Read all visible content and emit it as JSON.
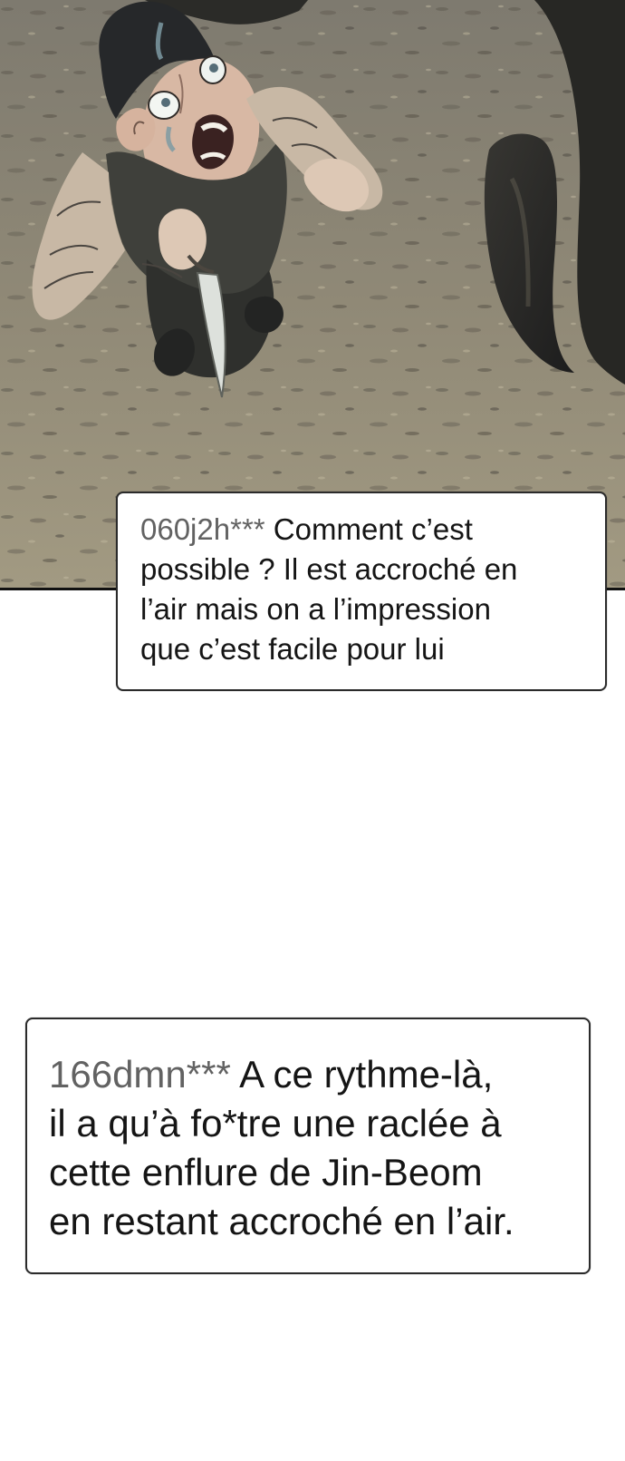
{
  "comic": {
    "panel": {
      "icon": "comic-panel-illustration"
    },
    "comments": [
      {
        "username": "060j2h***",
        "lines": [
          "Comment c’est",
          "possible ? Il est accroché en",
          "l’air mais on a l’impression",
          "que c’est facile pour lui"
        ]
      },
      {
        "username": "166dmn***",
        "lines": [
          "A ce rythme-là,",
          "il a qu’à fo*tre une raclée à",
          "cette enflure de Jin-Beom",
          "en restant accroché en l’air."
        ]
      }
    ]
  },
  "colors": {
    "ground": "#8b8576",
    "panel_border": "#111111",
    "comment_username": "#626262",
    "comment_text": "#151515"
  }
}
